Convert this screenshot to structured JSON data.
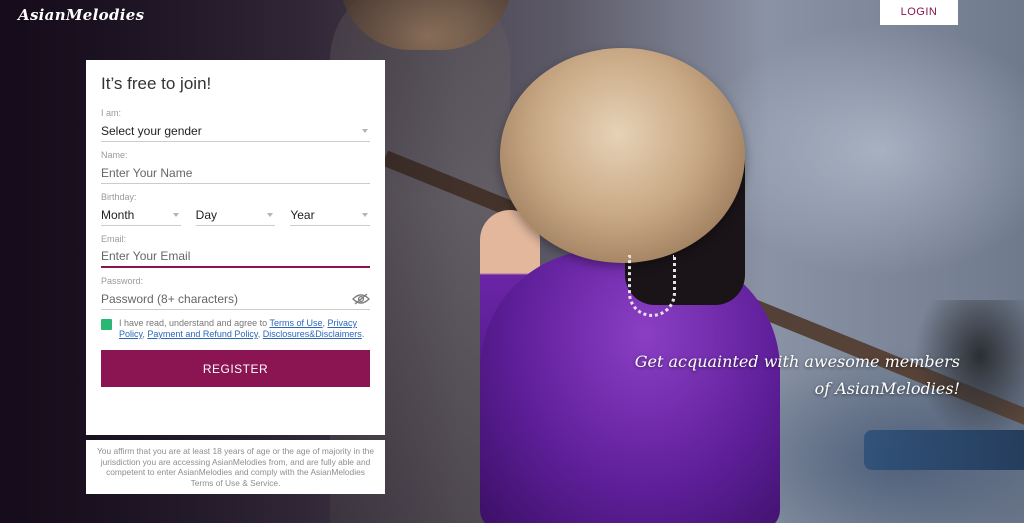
{
  "header": {
    "logo": "AsianMelodies",
    "login_label": "LOGIN"
  },
  "form": {
    "title": "It’s free to join!",
    "gender": {
      "label": "I am:",
      "value": "Select your gender"
    },
    "name": {
      "label": "Name:",
      "placeholder": "Enter Your Name"
    },
    "birthday": {
      "label": "Birthday:",
      "month": "Month",
      "day": "Day",
      "year": "Year"
    },
    "email": {
      "label": "Email:",
      "placeholder": "Enter Your Email"
    },
    "password": {
      "label": "Password:",
      "placeholder": "Password (8+ characters)"
    },
    "terms": {
      "prefix": "I have read, understand and agree to ",
      "terms_link": "Terms of Use",
      "sep1": ", ",
      "privacy_link": "Privacy Policy",
      "sep2": ", ",
      "refund_link": "Payment and Refund Policy",
      "sep3": ", ",
      "disclosures_link": "Disclosures&Disclaimers",
      "suffix": "."
    },
    "register_label": "REGISTER"
  },
  "disclaimer": "You affirm that you are at least 18 years of age or the age of majority in the jurisdiction you are accessing AsianMelodies from, and are fully able and competent to enter AsianMelodies and comply with the AsianMelodies Terms of Use & Service.",
  "tagline": {
    "line1": "Get acquainted with awesome members",
    "line2": "of AsianMelodies!"
  },
  "colors": {
    "brand": "#8b1452",
    "checkbox": "#2ab673",
    "link": "#2a67b9"
  },
  "icons": {
    "password_toggle": "eye-slash-icon",
    "select_caret": "caret-down-icon"
  }
}
